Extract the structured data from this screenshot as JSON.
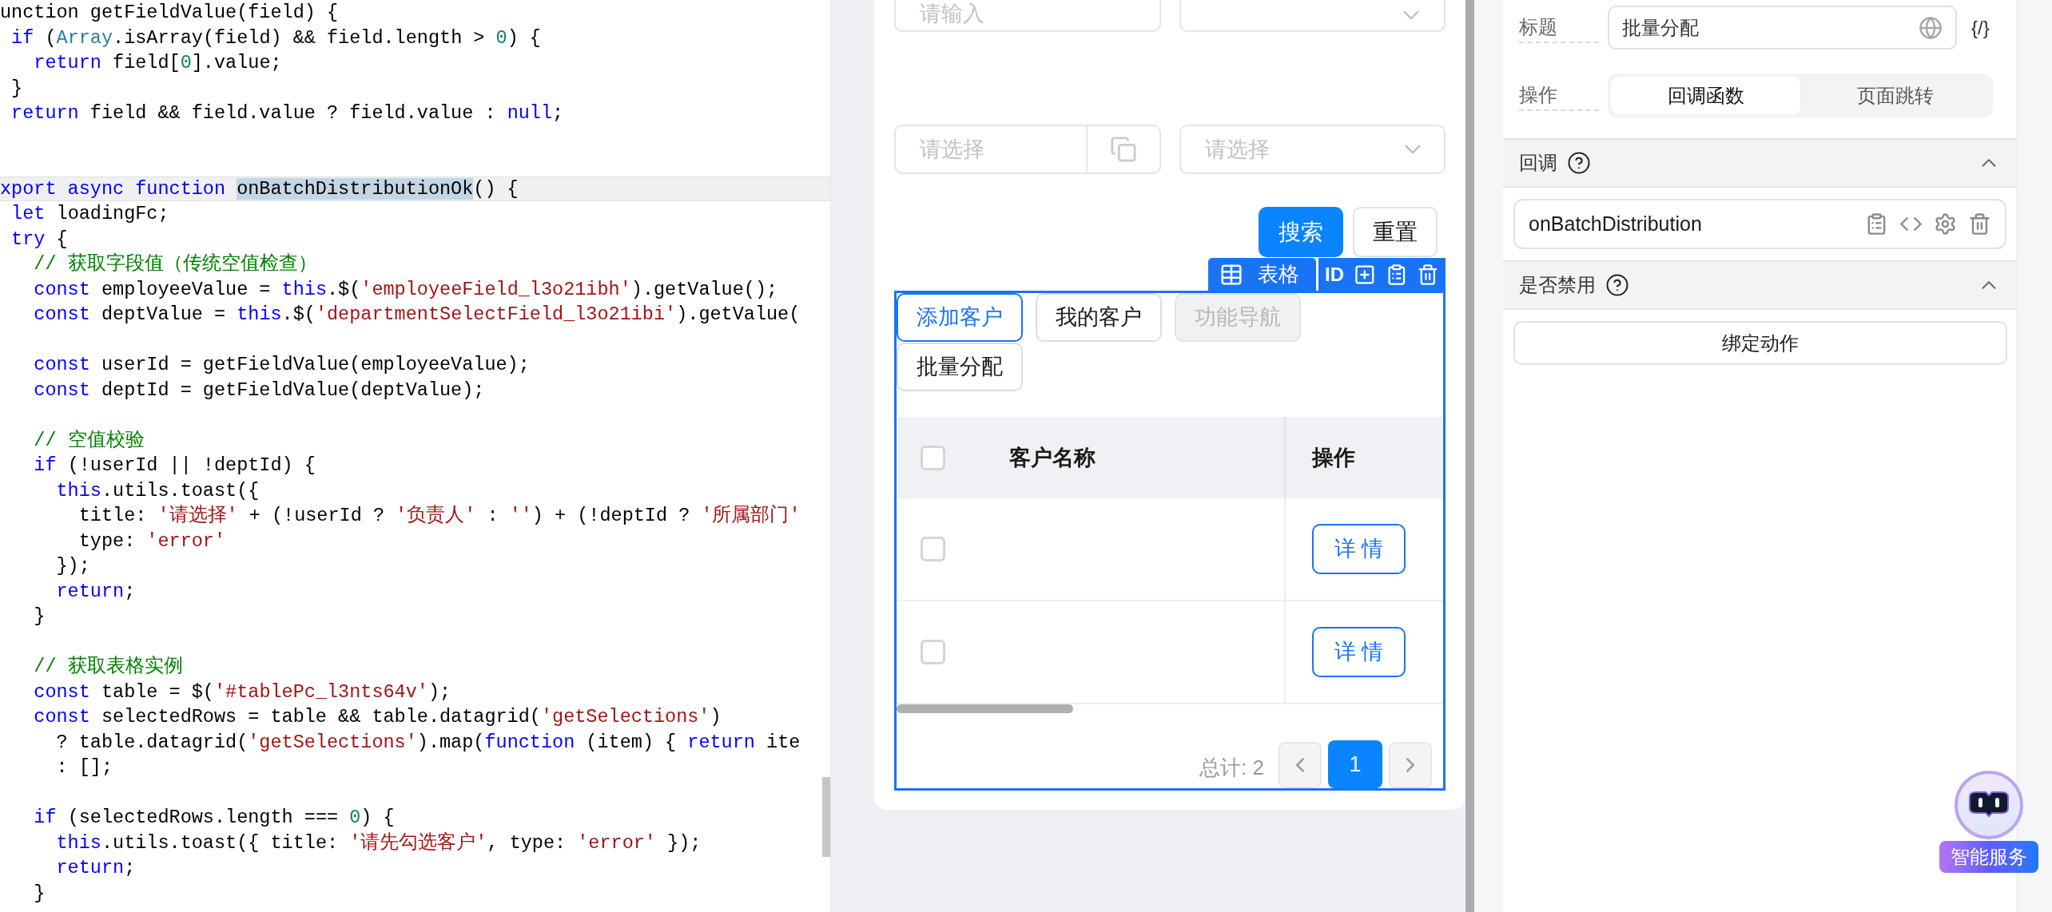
{
  "code": {
    "lines": [
      {
        "current": false,
        "tokens": [
          {
            "kind": "plain",
            "text": "unction getFieldValue(field) {"
          }
        ]
      },
      {
        "current": false,
        "tokens": [
          {
            "kind": "kw",
            "text": " if"
          },
          {
            "kind": "plain",
            "text": " ("
          },
          {
            "kind": "type",
            "text": "Array"
          },
          {
            "kind": "plain",
            "text": ".isArray(field) && field.length > "
          },
          {
            "kind": "num",
            "text": "0"
          },
          {
            "kind": "plain",
            "text": ") {"
          }
        ]
      },
      {
        "current": false,
        "tokens": [
          {
            "kind": "kw",
            "text": "   return"
          },
          {
            "kind": "plain",
            "text": " field["
          },
          {
            "kind": "num",
            "text": "0"
          },
          {
            "kind": "plain",
            "text": "].value;"
          }
        ]
      },
      {
        "current": false,
        "tokens": [
          {
            "kind": "plain",
            "text": " }"
          }
        ]
      },
      {
        "current": false,
        "tokens": [
          {
            "kind": "kw",
            "text": " return"
          },
          {
            "kind": "plain",
            "text": " field && field.value ? field.value : "
          },
          {
            "kind": "kw",
            "text": "null"
          },
          {
            "kind": "plain",
            "text": ";"
          }
        ]
      },
      {
        "current": false
      },
      {
        "current": false
      },
      {
        "current": true,
        "tokens": [
          {
            "kind": "kw",
            "text": "xport async function "
          },
          {
            "kind": "sel",
            "text": "onBatchDistributionOk"
          },
          {
            "kind": "plain",
            "text": "() {"
          }
        ]
      },
      {
        "current": false,
        "tokens": [
          {
            "kind": "kw",
            "text": " let"
          },
          {
            "kind": "plain",
            "text": " loadingFc;"
          }
        ]
      },
      {
        "current": false,
        "tokens": [
          {
            "kind": "kw",
            "text": " try"
          },
          {
            "kind": "plain",
            "text": " {"
          }
        ]
      },
      {
        "current": false,
        "tokens": [
          {
            "kind": "cm",
            "text": "   // 获取字段值（传统空值检查）"
          }
        ]
      },
      {
        "current": false,
        "tokens": [
          {
            "kind": "kw",
            "text": "   const"
          },
          {
            "kind": "plain",
            "text": " employeeValue = "
          },
          {
            "kind": "kw",
            "text": "this"
          },
          {
            "kind": "plain",
            "text": ".$("
          },
          {
            "kind": "str",
            "text": "'employeeField_l3o21ibh'"
          },
          {
            "kind": "plain",
            "text": ").getValue();"
          }
        ]
      },
      {
        "current": false,
        "tokens": [
          {
            "kind": "kw",
            "text": "   const"
          },
          {
            "kind": "plain",
            "text": " deptValue = "
          },
          {
            "kind": "kw",
            "text": "this"
          },
          {
            "kind": "plain",
            "text": ".$("
          },
          {
            "kind": "str",
            "text": "'departmentSelectField_l3o21ibi'"
          },
          {
            "kind": "plain",
            "text": ").getValue("
          }
        ]
      },
      {
        "current": false
      },
      {
        "current": false,
        "tokens": [
          {
            "kind": "kw",
            "text": "   const"
          },
          {
            "kind": "plain",
            "text": " userId = getFieldValue(employeeValue);"
          }
        ]
      },
      {
        "current": false,
        "tokens": [
          {
            "kind": "kw",
            "text": "   const"
          },
          {
            "kind": "plain",
            "text": " deptId = getFieldValue(deptValue);"
          }
        ]
      },
      {
        "current": false
      },
      {
        "current": false,
        "tokens": [
          {
            "kind": "cm",
            "text": "   // 空值校验"
          }
        ]
      },
      {
        "current": false,
        "tokens": [
          {
            "kind": "kw",
            "text": "   if"
          },
          {
            "kind": "plain",
            "text": " (!userId || !deptId) {"
          }
        ]
      },
      {
        "current": false,
        "tokens": [
          {
            "kind": "kw",
            "text": "     this"
          },
          {
            "kind": "plain",
            "text": ".utils.toast({"
          }
        ]
      },
      {
        "current": false,
        "tokens": [
          {
            "kind": "plain",
            "text": "       title: "
          },
          {
            "kind": "str",
            "text": "'请选择'"
          },
          {
            "kind": "plain",
            "text": " + (!userId ? "
          },
          {
            "kind": "str",
            "text": "'负责人'"
          },
          {
            "kind": "plain",
            "text": " : "
          },
          {
            "kind": "str",
            "text": "''"
          },
          {
            "kind": "plain",
            "text": ") + (!deptId ? "
          },
          {
            "kind": "str",
            "text": "'所属部门'"
          }
        ]
      },
      {
        "current": false,
        "tokens": [
          {
            "kind": "plain",
            "text": "       type: "
          },
          {
            "kind": "str",
            "text": "'error'"
          }
        ]
      },
      {
        "current": false,
        "tokens": [
          {
            "kind": "plain",
            "text": "     });"
          }
        ]
      },
      {
        "current": false,
        "tokens": [
          {
            "kind": "kw",
            "text": "     return"
          },
          {
            "kind": "plain",
            "text": ";"
          }
        ]
      },
      {
        "current": false,
        "tokens": [
          {
            "kind": "plain",
            "text": "   }"
          }
        ]
      },
      {
        "current": false
      },
      {
        "current": false,
        "tokens": [
          {
            "kind": "cm",
            "text": "   // 获取表格实例"
          }
        ]
      },
      {
        "current": false,
        "tokens": [
          {
            "kind": "kw",
            "text": "   const"
          },
          {
            "kind": "plain",
            "text": " table = $("
          },
          {
            "kind": "str",
            "text": "'#tablePc_l3nts64v'"
          },
          {
            "kind": "plain",
            "text": ");"
          }
        ]
      },
      {
        "current": false,
        "tokens": [
          {
            "kind": "kw",
            "text": "   const"
          },
          {
            "kind": "plain",
            "text": " selectedRows = table && table.datagrid("
          },
          {
            "kind": "str",
            "text": "'getSelections'"
          },
          {
            "kind": "plain",
            "text": ")"
          }
        ]
      },
      {
        "current": false,
        "tokens": [
          {
            "kind": "plain",
            "text": "     ? table.datagrid("
          },
          {
            "kind": "str",
            "text": "'getSelections'"
          },
          {
            "kind": "plain",
            "text": ").map("
          },
          {
            "kind": "kw",
            "text": "function"
          },
          {
            "kind": "plain",
            "text": " (item) { "
          },
          {
            "kind": "kw",
            "text": "return"
          },
          {
            "kind": "plain",
            "text": " ite"
          }
        ]
      },
      {
        "current": false,
        "tokens": [
          {
            "kind": "plain",
            "text": "     : [];"
          }
        ]
      },
      {
        "current": false
      },
      {
        "current": false,
        "tokens": [
          {
            "kind": "kw",
            "text": "   if"
          },
          {
            "kind": "plain",
            "text": " (selectedRows.length === "
          },
          {
            "kind": "num",
            "text": "0"
          },
          {
            "kind": "plain",
            "text": ") {"
          }
        ]
      },
      {
        "current": false,
        "tokens": [
          {
            "kind": "kw",
            "text": "     this"
          },
          {
            "kind": "plain",
            "text": ".utils.toast({ title: "
          },
          {
            "kind": "str",
            "text": "'请先勾选客户'"
          },
          {
            "kind": "plain",
            "text": ", type: "
          },
          {
            "kind": "str",
            "text": "'error'"
          },
          {
            "kind": "plain",
            "text": " });"
          }
        ]
      },
      {
        "current": false,
        "tokens": [
          {
            "kind": "kw",
            "text": "     return"
          },
          {
            "kind": "plain",
            "text": ";"
          }
        ]
      },
      {
        "current": false,
        "tokens": [
          {
            "kind": "plain",
            "text": "   }"
          }
        ]
      }
    ]
  },
  "canvas": {
    "filters": [
      {
        "kind": "input",
        "placeholder": "请输入"
      },
      {
        "kind": "select"
      },
      {
        "kind": "picker",
        "placeholder": "请选择"
      },
      {
        "kind": "select",
        "placeholder": "请选择"
      }
    ],
    "search_button": "搜索",
    "reset_button": "重置",
    "selection_toolbar": {
      "tag": "表格",
      "id_label": "ID"
    },
    "table_widget": {
      "actions": [
        {
          "label": "添加客户",
          "selected": true,
          "disabled": false
        },
        {
          "label": "我的客户",
          "selected": false,
          "disabled": false
        },
        {
          "label": "功能导航",
          "selected": false,
          "disabled": true
        },
        {
          "label": "批量分配",
          "selected": false,
          "disabled": false
        }
      ],
      "header_checked": false,
      "columns": [
        "客户名称",
        "操作"
      ],
      "rows": [
        {
          "checked": false,
          "action": "详 情"
        },
        {
          "checked": false,
          "action": "详 情"
        }
      ],
      "total": "总计: 2",
      "pages": [
        {
          "label": "1",
          "selected": true
        }
      ]
    }
  },
  "properties": {
    "title_field": {
      "label": "标题",
      "value": "批量分配",
      "expression_toggle": "{/}"
    },
    "action_field": {
      "label": "操作",
      "options": [
        {
          "label": "回调函数",
          "selected": true
        },
        {
          "label": "页面跳转",
          "selected": false
        }
      ]
    },
    "sections": [
      {
        "title": "回调",
        "expanded": true,
        "callbacks": [
          "onBatchDistribution"
        ]
      },
      {
        "title": "是否禁用",
        "expanded": true,
        "button": "绑定动作"
      }
    ]
  },
  "assistant": {
    "label": "智能服务"
  }
}
